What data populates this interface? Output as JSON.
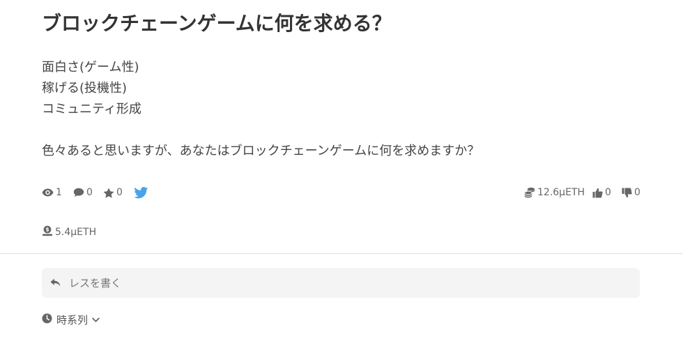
{
  "post": {
    "title": "ブロックチェーンゲームに何を求める？",
    "body_lines": [
      "面白さ(ゲーム性)",
      "稼げる(投機性)",
      "コミュニティ形成",
      "",
      "色々あると思いますが、あなたはブロックチェーンゲームに何を求めますか？"
    ]
  },
  "stats": {
    "views": "1",
    "comments": "0",
    "favorites": "0",
    "reward": "12.6μETH",
    "likes": "0",
    "dislikes": "0",
    "tip": "5.4μETH"
  },
  "reply": {
    "placeholder": "レスを書く"
  },
  "sort": {
    "label": "時系列"
  },
  "colors": {
    "twitter": "#4aa3e8",
    "icon": "#666666",
    "reply_bg": "#f4f4f4",
    "divider": "#dddddd"
  }
}
